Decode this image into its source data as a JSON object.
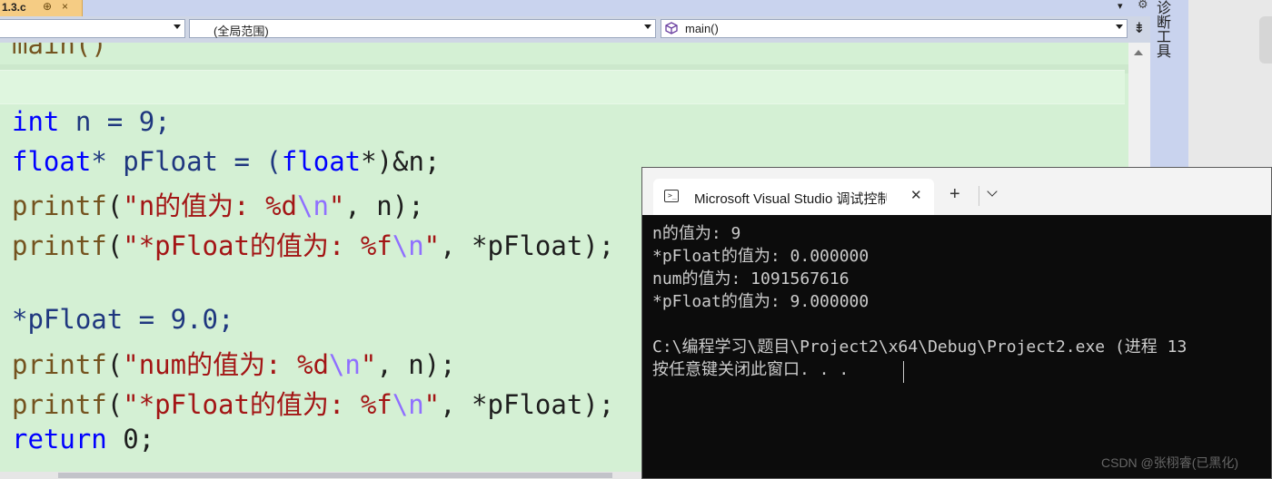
{
  "tabstrip": {
    "active_tab_label": "1.3.c",
    "pin_glyph": "⊕",
    "close_glyph": "×",
    "overflow_glyph": "▾"
  },
  "navbar": {
    "project_dropdown": "",
    "scope_dropdown": "(全局范围)",
    "member_dropdown": "main()",
    "split_glyph": "⇟"
  },
  "editor": {
    "lines": {
      "l0": "main()",
      "l2_kw": "int",
      "l2_rest": " n = 9;",
      "l3_kw1": "float",
      "l3_a": "* pFloat = (",
      "l3_kw2": "float",
      "l3_b": "*)&n;",
      "l4_fn": "printf",
      "l4_open": "(",
      "l4_str": "\"n的值为: %d",
      "l4_esc": "\\n",
      "l4_strend": "\"",
      "l4_rest": ", n);",
      "l5_fn": "printf",
      "l5_open": "(",
      "l5_str": "\"*pFloat的值为: %f",
      "l5_esc": "\\n",
      "l5_strend": "\"",
      "l5_rest": ", *pFloat);",
      "l7": "*pFloat = 9.0;",
      "l8_fn": "printf",
      "l8_open": "(",
      "l8_str": "\"num的值为: %d",
      "l8_esc": "\\n",
      "l8_strend": "\"",
      "l8_rest": ", n);",
      "l9_fn": "printf",
      "l9_open": "(",
      "l9_str": "\"*pFloat的值为: %f",
      "l9_esc": "\\n",
      "l9_strend": "\"",
      "l9_rest": ", *pFloat);",
      "l10_kw": "return",
      "l10_rest": " 0;"
    }
  },
  "side_panel": {
    "label": "诊断工具"
  },
  "terminal": {
    "tab_title": "Microsoft Visual Studio 调试控制台",
    "close_glyph": "✕",
    "new_tab_glyph": "+",
    "output": [
      "n的值为: 9",
      "*pFloat的值为: 0.000000",
      "num的值为: 1091567616",
      "*pFloat的值为: 9.000000",
      "",
      "C:\\编程学习\\题目\\Project2\\x64\\Debug\\Project2.exe (进程 13",
      "按任意键关闭此窗口. . ."
    ]
  },
  "watermark": "CSDN @张栩睿(已黑化)",
  "colors": {
    "editor_bg": "#d4f0d4",
    "keyword": "#0000ff",
    "string": "#a31515",
    "escape": "#8f6fff",
    "terminal_bg": "#0c0c0c",
    "tab_active": "#f5cc84"
  }
}
